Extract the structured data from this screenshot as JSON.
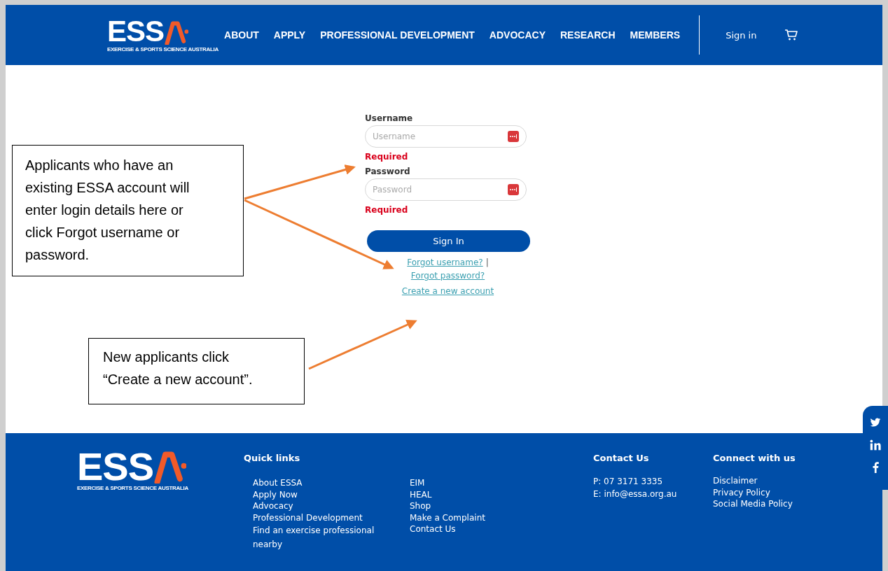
{
  "header": {
    "logo": {
      "wordmark": "ESS",
      "tagline": "EXERCISE & SPORTS SCIENCE AUSTRALIA"
    },
    "nav": [
      "ABOUT",
      "APPLY",
      "PROFESSIONAL DEVELOPMENT",
      "ADVOCACY",
      "RESEARCH",
      "MEMBERS"
    ],
    "sign_in": "Sign in"
  },
  "login": {
    "fields": [
      {
        "label": "Username",
        "placeholder": "Username",
        "error": "Required"
      },
      {
        "label": "Password",
        "placeholder": "Password",
        "error": "Required"
      }
    ],
    "button": "Sign In",
    "forgot_username": "Forgot username?",
    "separator": "|",
    "forgot_password": "Forgot password?",
    "create_account": "Create a new account"
  },
  "callouts": [
    {
      "text": "Applicants who have an existing ESSA account will enter login details here or click Forgot username or password."
    },
    {
      "text": "New applicants click “Create a new account”."
    }
  ],
  "footer": {
    "logo": {
      "wordmark": "ESS",
      "tagline": "EXERCISE & SPORTS SCIENCE AUSTRALIA"
    },
    "quick_links": {
      "title": "Quick links",
      "column_1": [
        "About ESSA",
        "Apply Now",
        "Advocacy",
        "Professional Development",
        "Find an exercise professional nearby"
      ],
      "column_2": [
        "EIM",
        "HEAL",
        "Shop",
        "Make a Complaint",
        "Contact Us"
      ]
    },
    "contact": {
      "title": "Contact Us",
      "lines": [
        "P: 07 3171 3335",
        "E: info@essa.org.au"
      ]
    },
    "connect": {
      "title": "Connect with us",
      "links": [
        "Disclaimer",
        "Privacy Policy",
        "Social Media Policy"
      ]
    }
  }
}
